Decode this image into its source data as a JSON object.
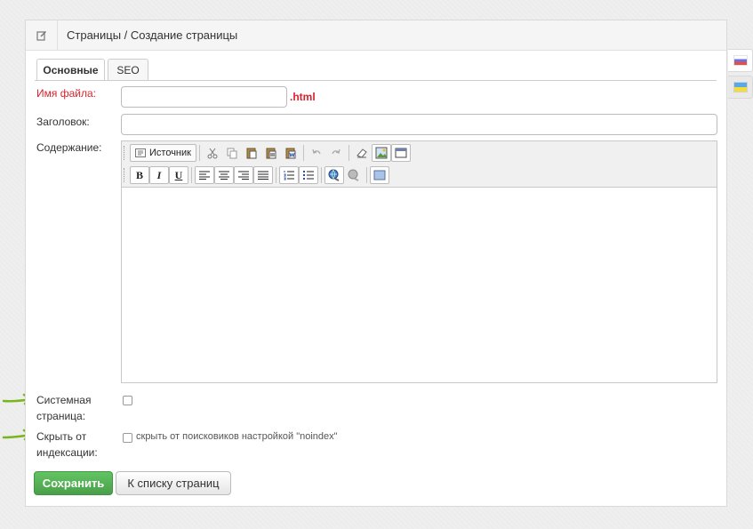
{
  "header": {
    "title": "Страницы / Создание страницы",
    "icon": "edit-icon"
  },
  "tabs": [
    {
      "label": "Основные",
      "active": true
    },
    {
      "label": "SEO",
      "active": false
    }
  ],
  "form": {
    "filename": {
      "label": "Имя файла:",
      "value": "",
      "suffix": ".html"
    },
    "title": {
      "label": "Заголовок:",
      "value": ""
    },
    "content": {
      "label": "Содержание:",
      "source_label": "Источник"
    },
    "system_page": {
      "label_line1": "Системная",
      "label_line2": "страница:",
      "checked": false
    },
    "hide_index": {
      "label_line1": "Скрыть от",
      "label_line2": "индексации:",
      "checked": false,
      "text": "скрыть от поисковиков настройкой \"noindex\""
    }
  },
  "buttons": {
    "save": "Сохранить",
    "back": "К списку страниц"
  },
  "toolbar_row2": {
    "bold": "B",
    "italic": "I",
    "underline": "U"
  },
  "languages": [
    {
      "code": "ru",
      "active": true
    },
    {
      "code": "ua",
      "active": false
    }
  ],
  "colors": {
    "required": "#d9232d",
    "save": "#5cb85c",
    "arrow": "#7ab51d"
  }
}
